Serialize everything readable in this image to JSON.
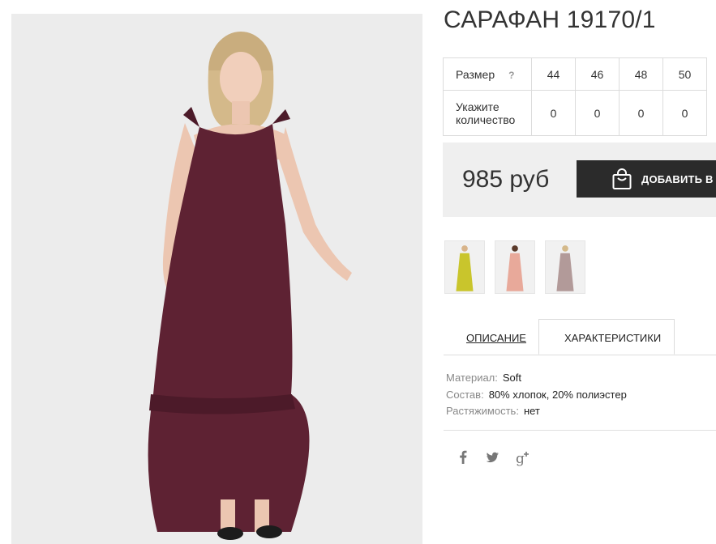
{
  "product": {
    "title": "САРАФАН 19170/1",
    "main_image": "woman-in-burgundy-maxi-dress",
    "dress_color": "#5e2233"
  },
  "sizes": {
    "size_label": "Размер",
    "help_mark": "?",
    "values": [
      "44",
      "46",
      "48",
      "50"
    ],
    "qty_label_line1": "Укажите",
    "qty_label_line2": "количество",
    "quantities": [
      "0",
      "0",
      "0",
      "0"
    ]
  },
  "purchase": {
    "price": "985 руб",
    "add_button_label": "ДОБАВИТЬ В ЗАКАЗ",
    "add_button_icon": "shopping-bag-icon"
  },
  "thumbnails": [
    {
      "name": "yellow-dress-variant",
      "color": "#c9c52c"
    },
    {
      "name": "pink-dress-variant",
      "color": "#e8a99a"
    },
    {
      "name": "mauve-dress-variant",
      "color": "#b29a99"
    }
  ],
  "tabs": {
    "description": "ОПИСАНИЕ",
    "characteristics": "ХАРАКТЕРИСТИКИ",
    "active": "characteristics"
  },
  "specs": [
    {
      "key": "Материал:",
      "value": "Soft"
    },
    {
      "key": "Состав:",
      "value": "80% хлопок, 20% полиэстер"
    },
    {
      "key": "Растяжимость:",
      "value": "нет"
    }
  ],
  "social": [
    "facebook-icon",
    "twitter-icon",
    "google-plus-icon"
  ],
  "colors": {
    "accent_dark": "#2b2b2b",
    "panel_bg": "#efefef",
    "border": "#dcdcdc"
  }
}
